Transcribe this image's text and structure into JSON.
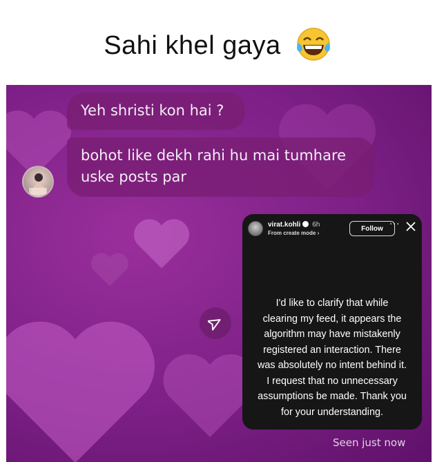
{
  "caption": {
    "text": "Sahi khel gaya",
    "emoji": "face-with-tears-of-joy"
  },
  "chat": {
    "messages": [
      {
        "text": "Yeh shristi kon hai ?"
      },
      {
        "line1": "bohot like dekh rahi hu mai tumhare",
        "line2": "uske posts par"
      }
    ],
    "status": "Seen just now",
    "background_color": "#7c1f86"
  },
  "story": {
    "username": "virat.kohli",
    "time": "6h",
    "subtitle": "From create mode ›",
    "follow_label": "Follow",
    "more_label": "···",
    "lines": [
      "I'd like to clarify that while",
      "clearing my feed, it appears the",
      "algorithm may have mistakenly",
      "registered an interaction. There",
      "was absolutely no intent behind it.",
      "I request that no unnecessary",
      "assumptions be made. Thank you",
      "for your understanding."
    ]
  }
}
